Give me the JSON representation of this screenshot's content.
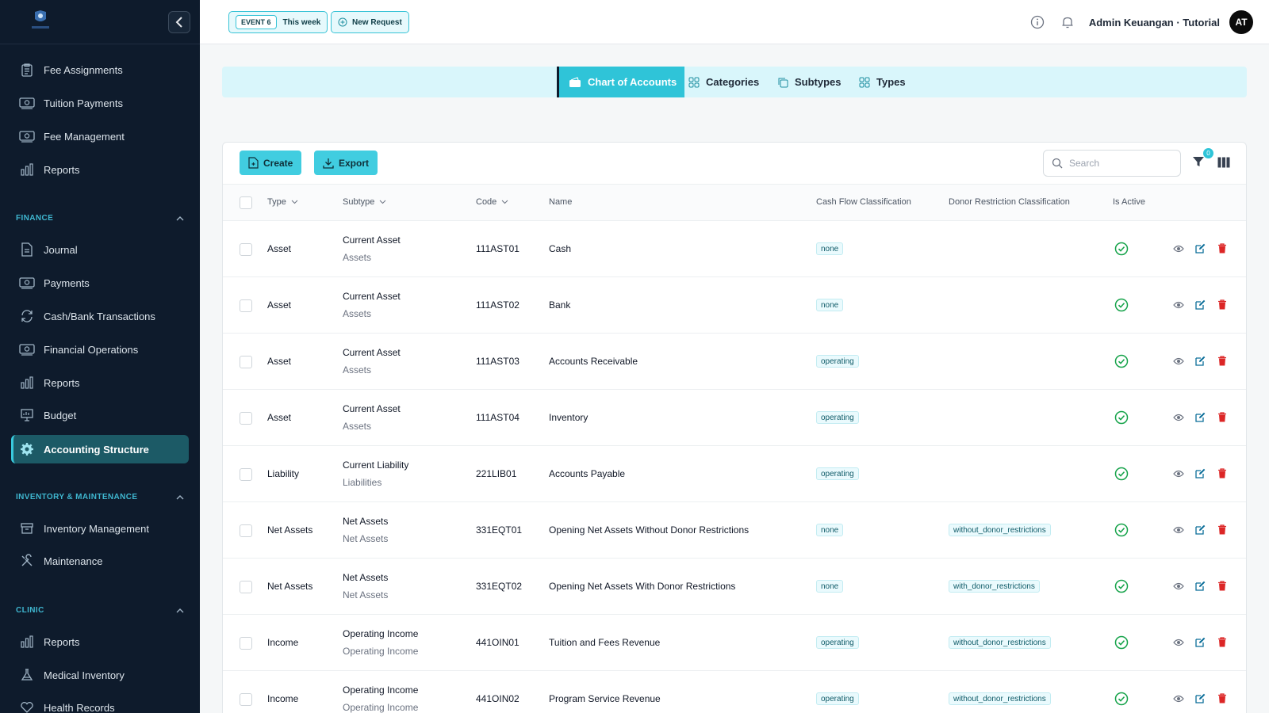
{
  "sidebar": {
    "logo_icon": "school-crest-icon",
    "top_items": [
      {
        "label": "Fee Assignments",
        "icon": "clipboard-icon"
      },
      {
        "label": "Tuition Payments",
        "icon": "money-icon"
      },
      {
        "label": "Fee Management",
        "icon": "money-icon"
      },
      {
        "label": "Reports",
        "icon": "bar-chart-icon"
      }
    ],
    "finance": {
      "title": "FINANCE",
      "items": [
        {
          "label": "Journal",
          "icon": "document-icon"
        },
        {
          "label": "Payments",
          "icon": "money-icon"
        },
        {
          "label": "Cash/Bank Transactions",
          "icon": "refresh-icon"
        },
        {
          "label": "Financial Operations",
          "icon": "money-icon"
        },
        {
          "label": "Reports",
          "icon": "bar-chart-icon"
        },
        {
          "label": "Budget",
          "icon": "presentation-icon"
        },
        {
          "label": "Accounting Structure",
          "icon": "gear-icon",
          "active": true
        }
      ]
    },
    "inventory": {
      "title": "INVENTORY & MAINTENANCE",
      "items": [
        {
          "label": "Inventory Management",
          "icon": "archive-icon"
        },
        {
          "label": "Maintenance",
          "icon": "tools-icon"
        }
      ]
    },
    "clinic": {
      "title": "CLINIC",
      "items": [
        {
          "label": "Reports",
          "icon": "bar-chart-icon"
        },
        {
          "label": "Medical Inventory",
          "icon": "flask-icon"
        },
        {
          "label": "Health Records",
          "icon": "heart-icon"
        }
      ]
    }
  },
  "topbar": {
    "event_badge": "EVENT 6",
    "event_label": "This week",
    "new_request": "New Request",
    "user": "Admin Keuangan · Tutorial",
    "avatar": "AT"
  },
  "tabs": [
    {
      "label": "Chart of Accounts",
      "active": true
    },
    {
      "label": "Categories"
    },
    {
      "label": "Subtypes"
    },
    {
      "label": "Types"
    }
  ],
  "toolbar": {
    "create": "Create",
    "export": "Export",
    "search_placeholder": "Search",
    "filter_count": "0"
  },
  "table": {
    "headers": {
      "type": "Type",
      "subtype": "Subtype",
      "code": "Code",
      "name": "Name",
      "cashflow": "Cash Flow Classification",
      "donor": "Donor Restriction Classification",
      "active": "Is Active"
    },
    "rows": [
      {
        "type": "Asset",
        "subtype": "Current Asset",
        "subtype_group": "Assets",
        "code": "111AST01",
        "name": "Cash",
        "cashflow": "none",
        "donor": ""
      },
      {
        "type": "Asset",
        "subtype": "Current Asset",
        "subtype_group": "Assets",
        "code": "111AST02",
        "name": "Bank",
        "cashflow": "none",
        "donor": ""
      },
      {
        "type": "Asset",
        "subtype": "Current Asset",
        "subtype_group": "Assets",
        "code": "111AST03",
        "name": "Accounts Receivable",
        "cashflow": "operating",
        "donor": ""
      },
      {
        "type": "Asset",
        "subtype": "Current Asset",
        "subtype_group": "Assets",
        "code": "111AST04",
        "name": "Inventory",
        "cashflow": "operating",
        "donor": ""
      },
      {
        "type": "Liability",
        "subtype": "Current Liability",
        "subtype_group": "Liabilities",
        "code": "221LIB01",
        "name": "Accounts Payable",
        "cashflow": "operating",
        "donor": ""
      },
      {
        "type": "Net Assets",
        "subtype": "Net Assets",
        "subtype_group": "Net Assets",
        "code": "331EQT01",
        "name": "Opening Net Assets Without Donor Restrictions",
        "cashflow": "none",
        "donor": "without_donor_restrictions"
      },
      {
        "type": "Net Assets",
        "subtype": "Net Assets",
        "subtype_group": "Net Assets",
        "code": "331EQT02",
        "name": "Opening Net Assets With Donor Restrictions",
        "cashflow": "none",
        "donor": "with_donor_restrictions"
      },
      {
        "type": "Income",
        "subtype": "Operating Income",
        "subtype_group": "Operating Income",
        "code": "441OIN01",
        "name": "Tuition and Fees Revenue",
        "cashflow": "operating",
        "donor": "without_donor_restrictions"
      },
      {
        "type": "Income",
        "subtype": "Operating Income",
        "subtype_group": "Operating Income",
        "code": "441OIN02",
        "name": "Program Service Revenue",
        "cashflow": "operating",
        "donor": "without_donor_restrictions"
      }
    ]
  },
  "colors": {
    "sidebar_bg": "#0e1b2c",
    "accent": "#2fc4d8",
    "active_green": "#16a34a",
    "delete_red": "#dc2626",
    "edit_blue": "#0b6e99"
  }
}
